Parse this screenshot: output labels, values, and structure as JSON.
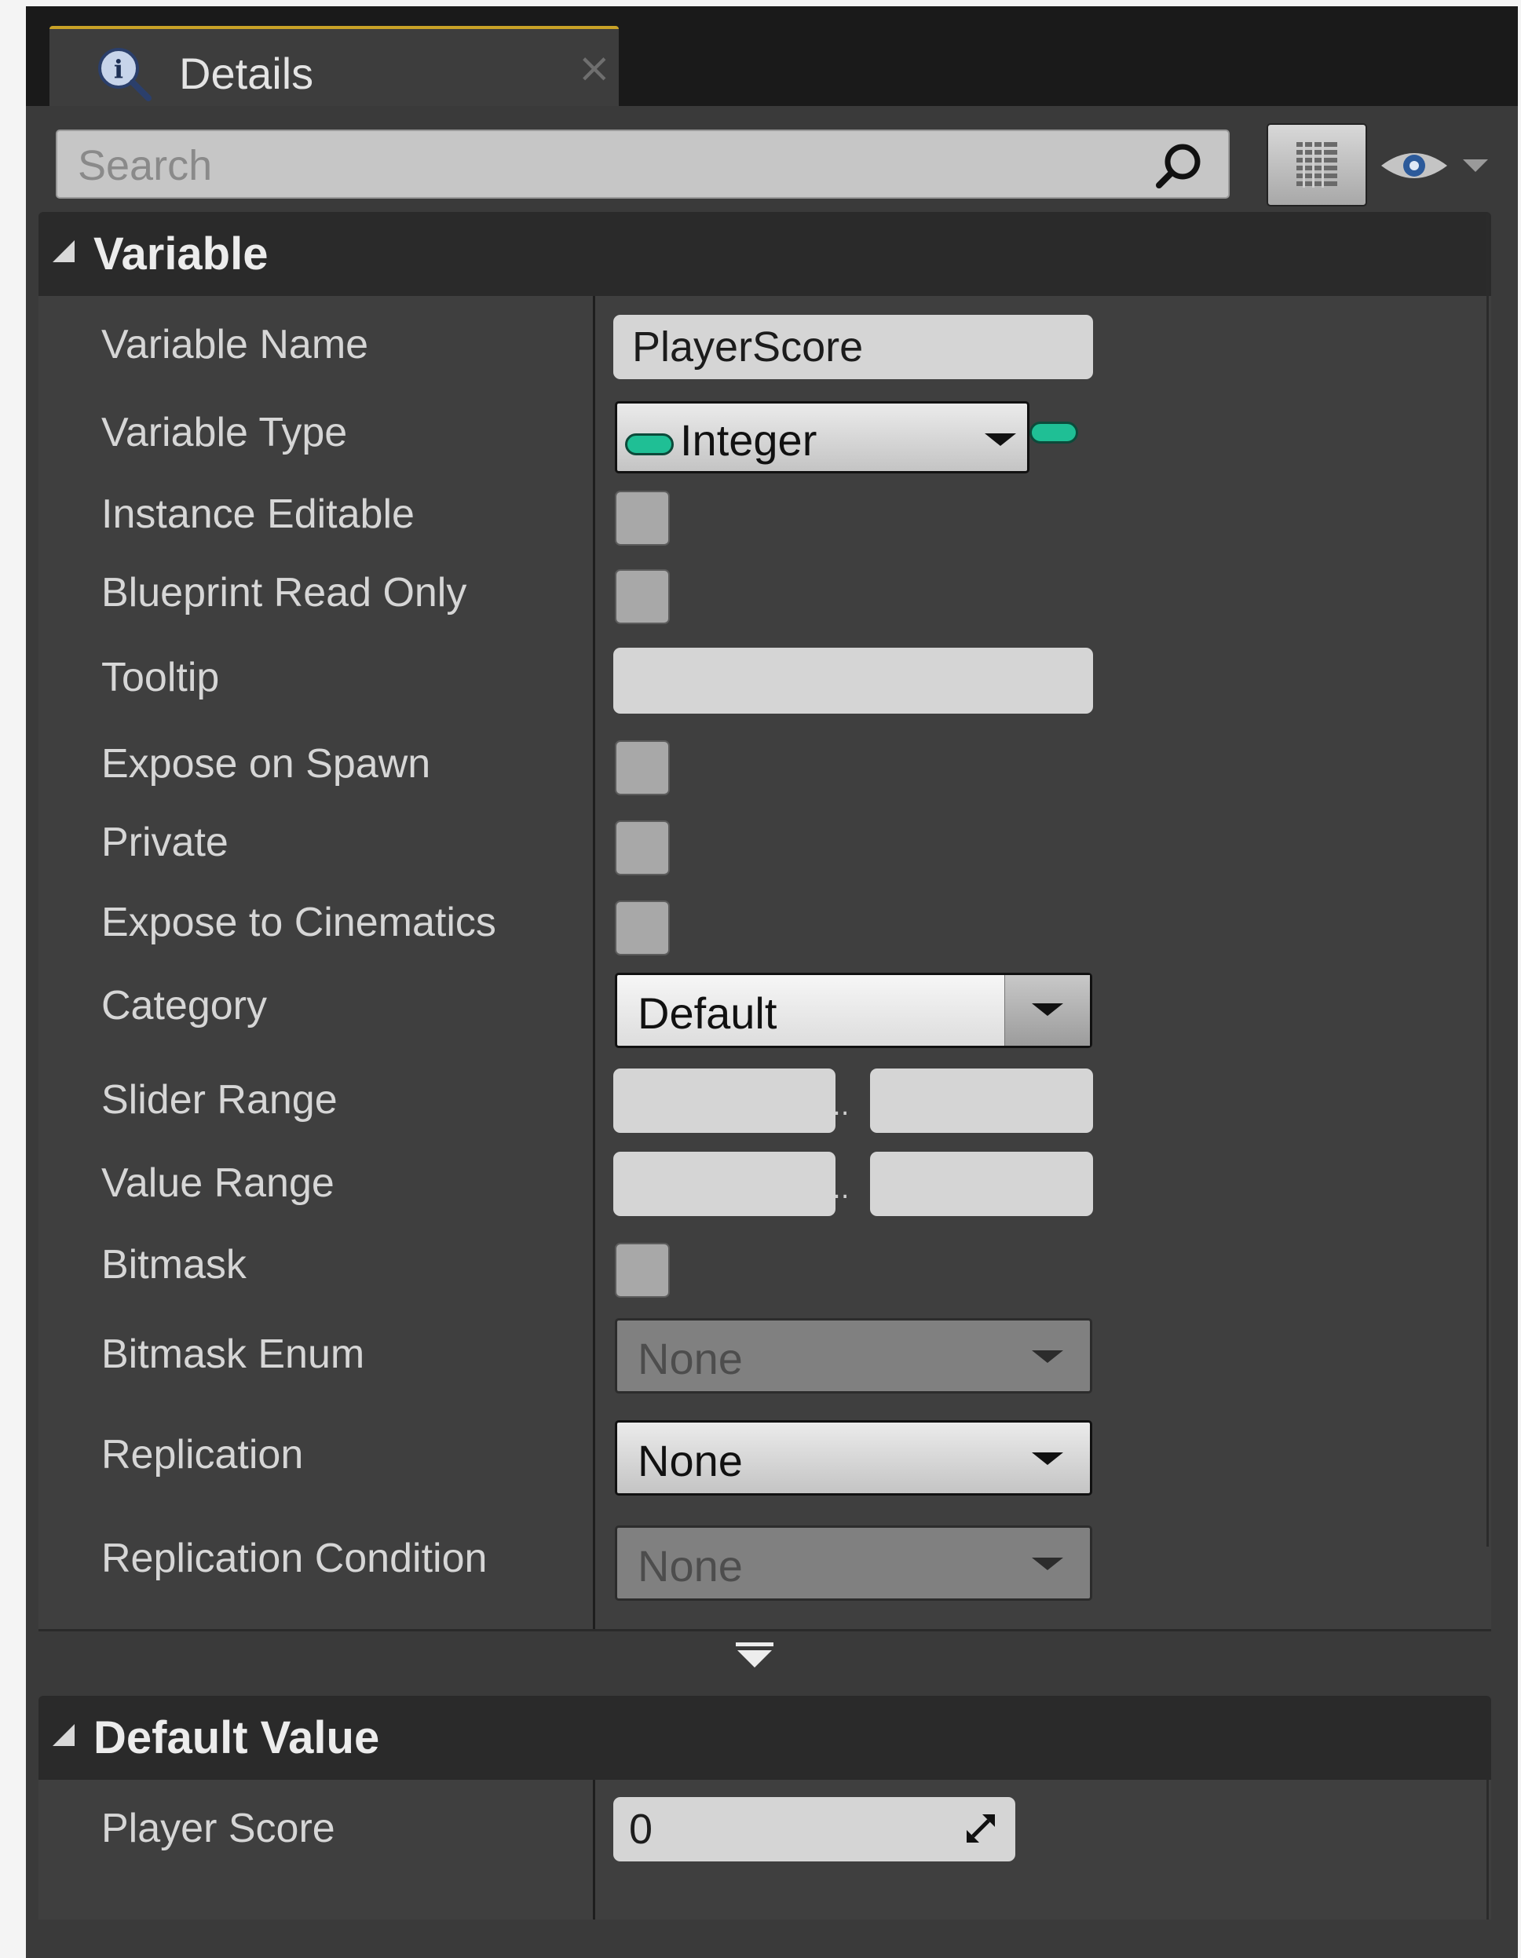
{
  "tab": {
    "title": "Details",
    "close_glyph": "×",
    "icon": "details-info-magnifier-icon"
  },
  "search": {
    "placeholder": "Search",
    "value": ""
  },
  "toolbar": {
    "view_options_icon": "list-view-icon",
    "visibility_icon": "eye-icon"
  },
  "variable_section": {
    "title": "Variable",
    "variable_name": {
      "label": "Variable Name",
      "value": "PlayerScore"
    },
    "variable_type": {
      "label": "Variable Type",
      "value": "Integer",
      "pin_color": "#1fbf95"
    },
    "instance_editable": {
      "label": "Instance Editable",
      "checked": false
    },
    "blueprint_read_only": {
      "label": "Blueprint Read Only",
      "checked": false
    },
    "tooltip": {
      "label": "Tooltip",
      "value": ""
    },
    "expose_on_spawn": {
      "label": "Expose on Spawn",
      "checked": false
    },
    "private": {
      "label": "Private",
      "checked": false
    },
    "expose_to_cinematics": {
      "label": "Expose to Cinematics",
      "checked": false
    },
    "category": {
      "label": "Category",
      "value": "Default"
    },
    "slider_range": {
      "label": "Slider Range",
      "min": "",
      "max": "",
      "separator": ".."
    },
    "value_range": {
      "label": "Value Range",
      "min": "",
      "max": "",
      "separator": ".."
    },
    "bitmask": {
      "label": "Bitmask",
      "checked": false
    },
    "bitmask_enum": {
      "label": "Bitmask Enum",
      "value": "None",
      "enabled": false
    },
    "replication": {
      "label": "Replication",
      "value": "None",
      "enabled": true
    },
    "replication_condition": {
      "label": "Replication Condition",
      "value": "None",
      "enabled": false
    }
  },
  "default_value_section": {
    "title": "Default Value",
    "player_score": {
      "label": "Player Score",
      "value": "0"
    }
  },
  "colors": {
    "panel_bg": "#3a3a3a",
    "tab_accent": "#c9a227",
    "integer_pin": "#1fbf95"
  }
}
